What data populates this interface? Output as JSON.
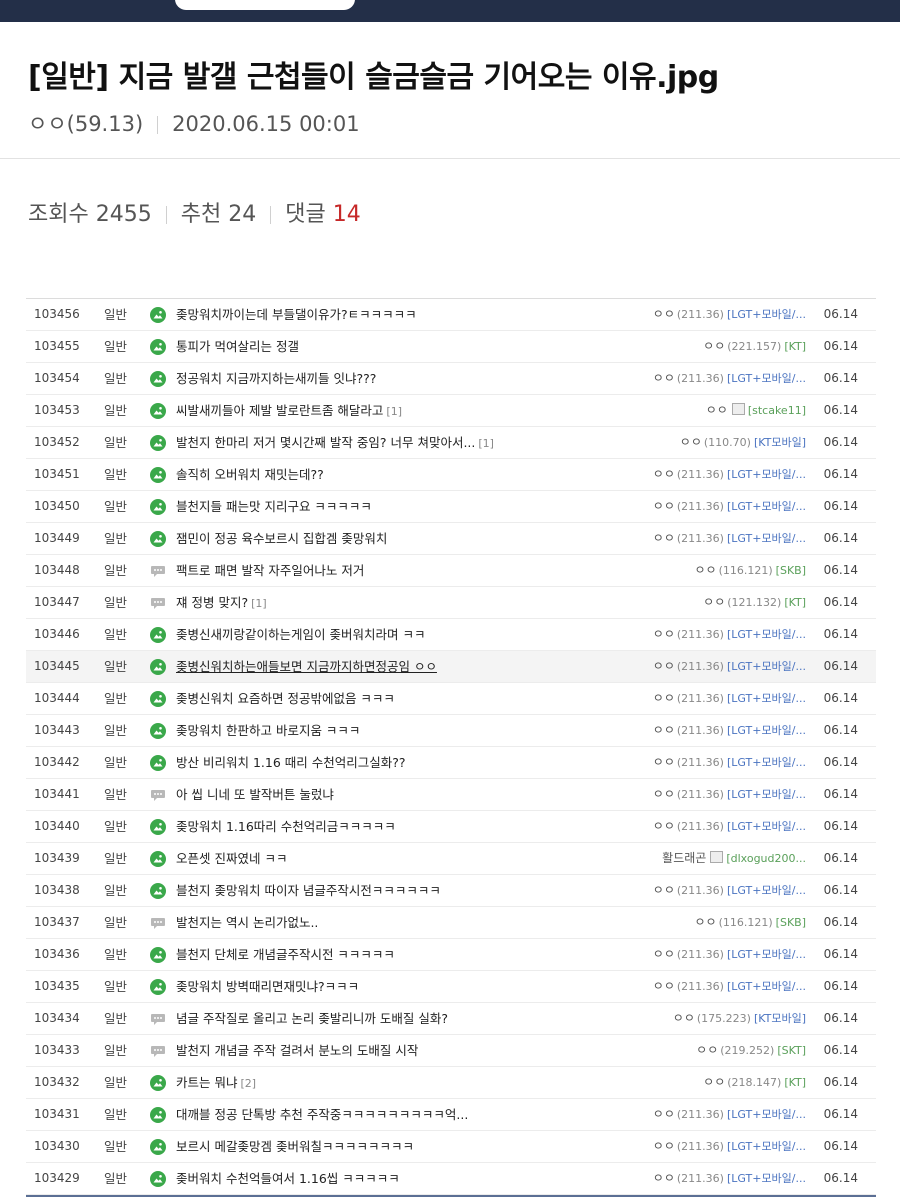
{
  "post": {
    "title": "[일반] 지금 발갤 근첩들이 슬금슬금 기어오는 이유.jpg",
    "author": "ㅇㅇ(59.13)",
    "datetime": "2020.06.15 00:01"
  },
  "stats": {
    "views_label": "조회수",
    "views": "2455",
    "recommend_label": "추천",
    "recommend": "24",
    "comments_label": "댓글",
    "comments": "14"
  },
  "colors": {
    "accent_red": "#c62828",
    "link_blue": "#4a73c0",
    "icon_green": "#3aa84a",
    "icon_gray": "#b8b8b8"
  },
  "list": [
    {
      "num": "103456",
      "cat": "일반",
      "icon": "image-post-icon",
      "title": "좆망워치까이는데 부들댈이유가?ㅌㅋㅋㅋㅋㅋ",
      "reply": "",
      "writer": "ㅇㅇ",
      "ip": "(211.36)",
      "ext": "[LGT+모바일/...",
      "has_img": false,
      "date": "06.14"
    },
    {
      "num": "103455",
      "cat": "일반",
      "icon": "image-post-icon",
      "title": "통피가 먹여살리는 정갤",
      "reply": "",
      "writer": "ㅇㅇ",
      "ip": "(221.157)",
      "ext": "[KT]",
      "has_img": false,
      "date": "06.14"
    },
    {
      "num": "103454",
      "cat": "일반",
      "icon": "image-post-icon",
      "title": "정공워치 지금까지하는새끼들 잇냐???",
      "reply": "",
      "writer": "ㅇㅇ",
      "ip": "(211.36)",
      "ext": "[LGT+모바일/...",
      "has_img": false,
      "date": "06.14"
    },
    {
      "num": "103453",
      "cat": "일반",
      "icon": "image-post-icon",
      "title": "씨발새끼들아 제발 발로란트좀 해달라고",
      "reply": "[1]",
      "writer": "ㅇㅇ",
      "ip": "",
      "ext": "[stcake11]",
      "has_img": true,
      "date": "06.14"
    },
    {
      "num": "103452",
      "cat": "일반",
      "icon": "image-post-icon",
      "title": "발천지 한마리 저거 몇시간째 발작 중임? 너무 쳐맞아서...",
      "reply": "[1]",
      "writer": "ㅇㅇ",
      "ip": "(110.70)",
      "ext": "[KT모바일]",
      "has_img": false,
      "date": "06.14"
    },
    {
      "num": "103451",
      "cat": "일반",
      "icon": "image-post-icon",
      "title": "솔직히 오버워치 재밋는데??",
      "reply": "",
      "writer": "ㅇㅇ",
      "ip": "(211.36)",
      "ext": "[LGT+모바일/...",
      "has_img": false,
      "date": "06.14"
    },
    {
      "num": "103450",
      "cat": "일반",
      "icon": "image-post-icon",
      "title": "블천지들 패는맛 지리구요 ㅋㅋㅋㅋㅋ",
      "reply": "",
      "writer": "ㅇㅇ",
      "ip": "(211.36)",
      "ext": "[LGT+모바일/...",
      "has_img": false,
      "date": "06.14"
    },
    {
      "num": "103449",
      "cat": "일반",
      "icon": "image-post-icon",
      "title": "잼민이 정공 육수보르시 집합겜 좆망워치",
      "reply": "",
      "writer": "ㅇㅇ",
      "ip": "(211.36)",
      "ext": "[LGT+모바일/...",
      "has_img": false,
      "date": "06.14"
    },
    {
      "num": "103448",
      "cat": "일반",
      "icon": "text-post-icon",
      "title": "팩트로 패면 발작 자주일어나노 저거",
      "reply": "",
      "writer": "ㅇㅇ",
      "ip": "(116.121)",
      "ext": "[SKB]",
      "has_img": false,
      "date": "06.14"
    },
    {
      "num": "103447",
      "cat": "일반",
      "icon": "text-post-icon",
      "title": "쟤 정병 맞지?",
      "reply": "[1]",
      "writer": "ㅇㅇ",
      "ip": "(121.132)",
      "ext": "[KT]",
      "has_img": false,
      "date": "06.14"
    },
    {
      "num": "103446",
      "cat": "일반",
      "icon": "image-post-icon",
      "title": "좆병신새끼랑같이하는게임이 좆버워치라며 ㅋㅋ",
      "reply": "",
      "writer": "ㅇㅇ",
      "ip": "(211.36)",
      "ext": "[LGT+모바일/...",
      "has_img": false,
      "date": "06.14"
    },
    {
      "num": "103445",
      "cat": "일반",
      "icon": "image-post-icon",
      "title": "좆병신워치하는애들보면 지금까지하면정공임 ㅇㅇ",
      "reply": "",
      "writer": "ㅇㅇ",
      "ip": "(211.36)",
      "ext": "[LGT+모바일/...",
      "has_img": false,
      "date": "06.14",
      "highlight": true
    },
    {
      "num": "103444",
      "cat": "일반",
      "icon": "image-post-icon",
      "title": "좆병신워치 요즘하면 정공밖에없음 ㅋㅋㅋ",
      "reply": "",
      "writer": "ㅇㅇ",
      "ip": "(211.36)",
      "ext": "[LGT+모바일/...",
      "has_img": false,
      "date": "06.14"
    },
    {
      "num": "103443",
      "cat": "일반",
      "icon": "image-post-icon",
      "title": "좆망워치 한판하고 바로지움 ㅋㅋㅋ",
      "reply": "",
      "writer": "ㅇㅇ",
      "ip": "(211.36)",
      "ext": "[LGT+모바일/...",
      "has_img": false,
      "date": "06.14"
    },
    {
      "num": "103442",
      "cat": "일반",
      "icon": "image-post-icon",
      "title": "방산 비리워치 1.16 때리 수천억리그실화??",
      "reply": "",
      "writer": "ㅇㅇ",
      "ip": "(211.36)",
      "ext": "[LGT+모바일/...",
      "has_img": false,
      "date": "06.14"
    },
    {
      "num": "103441",
      "cat": "일반",
      "icon": "text-post-icon",
      "title": "아 씹 니네 또 발작버튼 눌렀냐",
      "reply": "",
      "writer": "ㅇㅇ",
      "ip": "(211.36)",
      "ext": "[LGT+모바일/...",
      "has_img": false,
      "date": "06.14"
    },
    {
      "num": "103440",
      "cat": "일반",
      "icon": "image-post-icon",
      "title": "좆망워치 1.16따리 수천억리금ㅋㅋㅋㅋㅋ",
      "reply": "",
      "writer": "ㅇㅇ",
      "ip": "(211.36)",
      "ext": "[LGT+모바일/...",
      "has_img": false,
      "date": "06.14"
    },
    {
      "num": "103439",
      "cat": "일반",
      "icon": "image-post-icon",
      "title": "오픈셋 진짜였네 ㅋㅋ",
      "reply": "",
      "writer": "활드래곤",
      "ip": "",
      "ext": "[dlxogud200...",
      "has_img": true,
      "date": "06.14"
    },
    {
      "num": "103438",
      "cat": "일반",
      "icon": "image-post-icon",
      "title": "블천지 좆망워치 따이자 념글주작시전ㅋㅋㅋㅋㅋㅋ",
      "reply": "",
      "writer": "ㅇㅇ",
      "ip": "(211.36)",
      "ext": "[LGT+모바일/...",
      "has_img": false,
      "date": "06.14"
    },
    {
      "num": "103437",
      "cat": "일반",
      "icon": "text-post-icon",
      "title": "발천지는 역시 논리가없노..",
      "reply": "",
      "writer": "ㅇㅇ",
      "ip": "(116.121)",
      "ext": "[SKB]",
      "has_img": false,
      "date": "06.14"
    },
    {
      "num": "103436",
      "cat": "일반",
      "icon": "image-post-icon",
      "title": "블천지 단체로 개념글주작시전 ㅋㅋㅋㅋㅋ",
      "reply": "",
      "writer": "ㅇㅇ",
      "ip": "(211.36)",
      "ext": "[LGT+모바일/...",
      "has_img": false,
      "date": "06.14"
    },
    {
      "num": "103435",
      "cat": "일반",
      "icon": "image-post-icon",
      "title": "좆망워치 방벽때리면재밋냐?ㅋㅋㅋ",
      "reply": "",
      "writer": "ㅇㅇ",
      "ip": "(211.36)",
      "ext": "[LGT+모바일/...",
      "has_img": false,
      "date": "06.14"
    },
    {
      "num": "103434",
      "cat": "일반",
      "icon": "text-post-icon",
      "title": "념글 주작질로 올리고 논리 좆발리니까 도배질 실화?",
      "reply": "",
      "writer": "ㅇㅇ",
      "ip": "(175.223)",
      "ext": "[KT모바일]",
      "has_img": false,
      "date": "06.14"
    },
    {
      "num": "103433",
      "cat": "일반",
      "icon": "text-post-icon",
      "title": "발천지 개념글 주작 걸려서 분노의 도배질 시작",
      "reply": "",
      "writer": "ㅇㅇ",
      "ip": "(219.252)",
      "ext": "[SKT]",
      "has_img": false,
      "date": "06.14"
    },
    {
      "num": "103432",
      "cat": "일반",
      "icon": "image-post-icon",
      "title": "카트는 뭐냐",
      "reply": "[2]",
      "writer": "ㅇㅇ",
      "ip": "(218.147)",
      "ext": "[KT]",
      "has_img": false,
      "date": "06.14"
    },
    {
      "num": "103431",
      "cat": "일반",
      "icon": "image-post-icon",
      "title": "대깨블 정공 단톡방 추천 주작중ㅋㅋㅋㅋㅋㅋㅋㅋㅋ억...",
      "reply": "",
      "writer": "ㅇㅇ",
      "ip": "(211.36)",
      "ext": "[LGT+모바일/...",
      "has_img": false,
      "date": "06.14"
    },
    {
      "num": "103430",
      "cat": "일반",
      "icon": "image-post-icon",
      "title": "보르시 메갈좆망겜 좆버워칠ㅋㅋㅋㅋㅋㅋㅋㅋ",
      "reply": "",
      "writer": "ㅇㅇ",
      "ip": "(211.36)",
      "ext": "[LGT+모바일/...",
      "has_img": false,
      "date": "06.14"
    },
    {
      "num": "103429",
      "cat": "일반",
      "icon": "image-post-icon",
      "title": "좆버워치 수천억들여서 1.16씹 ㅋㅋㅋㅋㅋ",
      "reply": "",
      "writer": "ㅇㅇ",
      "ip": "(211.36)",
      "ext": "[LGT+모바일/...",
      "has_img": false,
      "date": "06.14"
    }
  ]
}
